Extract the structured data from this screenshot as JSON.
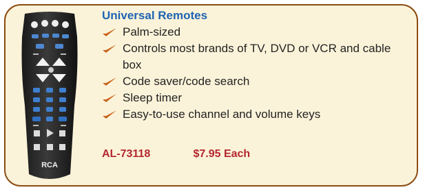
{
  "product": {
    "title": "Universal Remotes",
    "features": [
      "Palm-sized",
      "Controls most brands of TV, DVD or VCR and cable box",
      "Code saver/code search",
      "Sleep timer",
      "Easy-to-use channel and volume keys"
    ],
    "sku": "AL-73118",
    "price": "$7.95 Each",
    "brand_logo": "RCA"
  },
  "colors": {
    "title": "#1f63b3",
    "order": "#b3262f",
    "border": "#8a4b12",
    "card_bg": "#fbf3d9",
    "check": "#c8631a"
  },
  "icons": {
    "bullet": "check-icon",
    "product_image": "remote-control-image"
  }
}
